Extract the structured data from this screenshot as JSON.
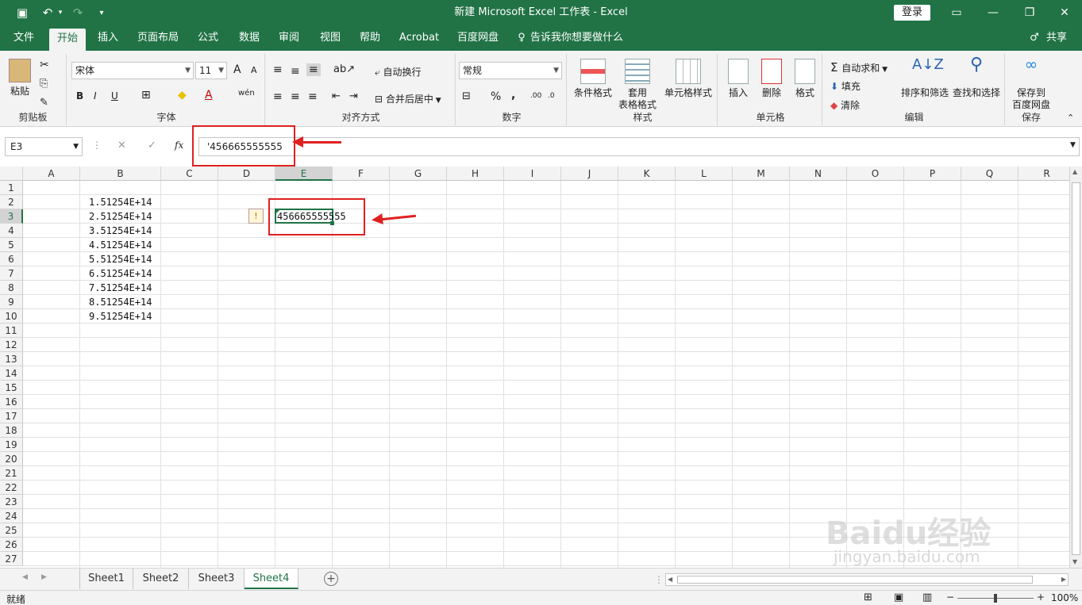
{
  "window": {
    "title": "新建 Microsoft Excel 工作表  -  Excel",
    "login": "登录"
  },
  "menu": {
    "tabs": [
      "文件",
      "开始",
      "插入",
      "页面布局",
      "公式",
      "数据",
      "审阅",
      "视图",
      "帮助",
      "Acrobat",
      "百度网盘"
    ],
    "tellme": "告诉我你想要做什么",
    "share": "共享"
  },
  "ribbon": {
    "clipboard": {
      "paste": "粘贴",
      "label": "剪贴板"
    },
    "font": {
      "name": "宋体",
      "size": "11",
      "bold": "B",
      "italic": "I",
      "underline": "U",
      "grow": "A",
      "shrink": "A",
      "phonetic": "wén",
      "label": "字体"
    },
    "align": {
      "wrap": "自动换行",
      "merge": "合并后居中",
      "label": "对齐方式"
    },
    "number": {
      "format": "常规",
      "percent": "%",
      "comma": ",",
      "inc": ".00",
      "dec": ".0",
      "label": "数字"
    },
    "styles": {
      "cond": "条件格式",
      "table_line1": "套用",
      "table_line2": "表格格式",
      "cell": "单元格样式",
      "label": "样式"
    },
    "cells": {
      "insert": "插入",
      "delete": "删除",
      "format": "格式",
      "label": "单元格"
    },
    "editing": {
      "autosum": "自动求和",
      "fill": "填充",
      "clear": "清除",
      "sort": "排序和筛选",
      "find": "查找和选择",
      "label": "编辑"
    },
    "save": {
      "line1": "保存到",
      "line2": "百度网盘",
      "label": "保存"
    }
  },
  "formula": {
    "namebox": "E3",
    "fx": "fx",
    "value": "'456665555555"
  },
  "columns": [
    "A",
    "B",
    "C",
    "D",
    "E",
    "F",
    "G",
    "H",
    "I",
    "J",
    "K",
    "L",
    "M",
    "N",
    "O",
    "P",
    "Q",
    "R"
  ],
  "rows": [
    "1",
    "2",
    "3",
    "4",
    "5",
    "6",
    "7",
    "8",
    "9",
    "10",
    "11",
    "12",
    "13",
    "14",
    "15",
    "16",
    "17",
    "18",
    "19",
    "20",
    "21",
    "22",
    "23",
    "24",
    "25",
    "26",
    "27"
  ],
  "cells": {
    "B": [
      "1.51254E+14",
      "2.51254E+14",
      "3.51254E+14",
      "4.51254E+14",
      "5.51254E+14",
      "6.51254E+14",
      "7.51254E+14",
      "8.51254E+14",
      "9.51254E+14"
    ],
    "E3": "456665555555"
  },
  "sheets": [
    "Sheet1",
    "Sheet2",
    "Sheet3",
    "Sheet4"
  ],
  "status": {
    "ready": "就绪",
    "zoom": "100%"
  },
  "watermark": {
    "brand": "Baidu经验",
    "url": "jingyan.baidu.com"
  },
  "colors": {
    "excel_green": "#217346",
    "annotation_red": "#e02020"
  }
}
